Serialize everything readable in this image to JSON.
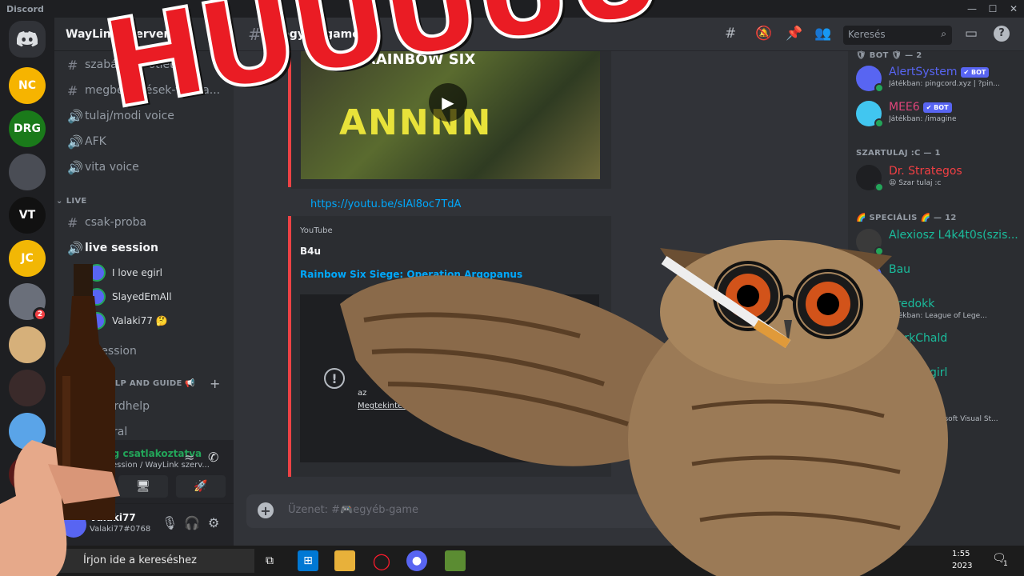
{
  "titlebar": {
    "app": "Discord",
    "min": "—",
    "max": "☐",
    "close": "✕"
  },
  "server": {
    "name": "WayLink szervere",
    "chevron": "⌄"
  },
  "guild_icons": [
    {
      "label": "NC",
      "bg": "#f6b400"
    },
    {
      "label": "DRG",
      "bg": "#1a7a1a"
    },
    {
      "label": "",
      "bg": "#4a4d55"
    },
    {
      "label": "VT",
      "bg": "#111111"
    },
    {
      "label": "JC",
      "bg": "#f2b705"
    },
    {
      "label": "",
      "bg": "#6a6f7a",
      "badge": "2"
    },
    {
      "label": "",
      "bg": "#d6b07a"
    },
    {
      "label": "",
      "bg": "#3a2a2a"
    },
    {
      "label": "",
      "bg": "#5aa4e8"
    },
    {
      "label": "",
      "bg": "#5a1a1a"
    },
    {
      "label": "",
      "bg": "#3b2a40"
    }
  ],
  "channels": [
    {
      "name": "szabályzat-ötletek",
      "icon": "#"
    },
    {
      "name": "megbeszélések-vissza...",
      "icon": "#"
    },
    {
      "name": "tulaj/modi voice",
      "icon": "🔊"
    },
    {
      "name": "AFK",
      "icon": "🔊"
    },
    {
      "name": "vita voice",
      "icon": "🔊"
    }
  ],
  "live_category": "LIVE",
  "live_channels": [
    {
      "name": "csak-proba",
      "icon": "#"
    },
    {
      "name": "live session",
      "icon": "🔊"
    }
  ],
  "voice_users": [
    "I love egirl",
    "SlayedEmAll",
    "Valaki77 🤔"
  ],
  "more_channels": [
    {
      "name": "o session",
      "icon": "🔊"
    }
  ],
  "help_category": "HELP AND GUIDE 📢",
  "help_channels": [
    {
      "name": "discordhelp",
      "icon": "#"
    },
    {
      "name": "general",
      "icon": "#"
    }
  ],
  "voice_panel": {
    "status": "Hang csatlakoztatva",
    "sub": "live session / WayLink szerv...",
    "noise_icon": "≈",
    "leave_icon": "✆"
  },
  "user": {
    "name": "Valaki77",
    "tag": "Valaki77#0768"
  },
  "channel_header": {
    "name": "🎮egyéb-game",
    "search_placeholder": "Keresés"
  },
  "messages": {
    "thumb_text_top": "RAINBOW SIX",
    "thumb_text_mid": "ANNNN",
    "link": "https://youtu.be/sIAl8oc7TdA",
    "provider": "YouTube",
    "author": "B4u",
    "video_title": "Rainbow Six Siege: Operation Argopanus",
    "error_text": "az",
    "error_link": "Megtekintés"
  },
  "input": {
    "placeholder": "Üzenet: #🎮egyéb-game"
  },
  "members": {
    "bot_category": "🛡 BOT 🛡 — 2",
    "bots": [
      {
        "name": "AlertSystem",
        "badge": "✔ BOT",
        "status": "Játékban: pingcord.xyz | ?pin...",
        "color": "#5865f2",
        "avbg": "#5865f2"
      },
      {
        "name": "MEE6",
        "badge": "✔ BOT",
        "status": "Játékban: /imagine",
        "color": "#e0457b",
        "avbg": "#41c6f0"
      }
    ],
    "owner_category": "SZARTULAJ :C — 1",
    "owners": [
      {
        "name": "Dr. Strategos",
        "status": "😫 Szar tulaj :c",
        "color": "#f23f43",
        "avbg": "#1e1f22"
      }
    ],
    "special_category": "🌈 SPECIÁLIS 🌈 — 12",
    "specials": [
      {
        "name": "Alexiosz L4k4t0s(szis...",
        "status": "",
        "color": "#1abc9c",
        "avbg": "#3a3a3a"
      },
      {
        "name": "Bau",
        "status": "",
        "color": "#1abc9c",
        "avbg": "#5865f2"
      },
      {
        "name": "Bredokk",
        "status": "Játékban: League of Lege...",
        "color": "#1abc9c",
        "avbg": "#5865f2"
      },
      {
        "name": "DarkChald",
        "status": "",
        "color": "#1abc9c",
        "avbg": "#5865f2"
      },
      {
        "name": "I love egirl",
        "status": "",
        "color": "#1abc9c",
        "avbg": "#5865f2"
      },
      {
        "name": "...",
        "status": "Játékban: Microsoft Visual St...",
        "color": "#1abc9c",
        "avbg": "#5865f2"
      },
      {
        "name": "...an",
        "status": "...e 2",
        "color": "#1abc9c",
        "avbg": "#5865f2"
      }
    ]
  },
  "taskbar": {
    "search": "Írjon ide a kereséshez",
    "time": "1:55",
    "date": "2023",
    "notif": "1"
  },
  "overlay": {
    "text": "HUUUUU"
  },
  "colors": {
    "accent": "#5865f2",
    "online": "#23a559",
    "danger": "#ed4245",
    "link": "#00a8fc"
  }
}
